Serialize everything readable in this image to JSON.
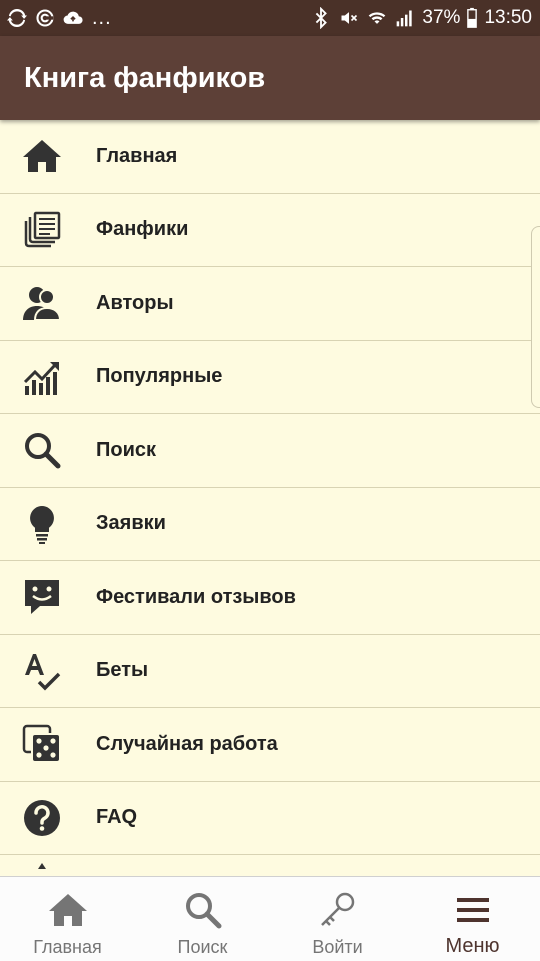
{
  "status_bar": {
    "dots": "...",
    "battery_percent": "37%",
    "time": "13:50"
  },
  "app_bar": {
    "title": "Книга фанфиков"
  },
  "menu": {
    "items": [
      {
        "label": "Главная",
        "icon": "home-icon"
      },
      {
        "label": "Фанфики",
        "icon": "documents-icon"
      },
      {
        "label": "Авторы",
        "icon": "authors-icon"
      },
      {
        "label": "Популярные",
        "icon": "trending-chart-icon"
      },
      {
        "label": "Поиск",
        "icon": "search-icon"
      },
      {
        "label": "Заявки",
        "icon": "lightbulb-icon"
      },
      {
        "label": "Фестивали отзывов",
        "icon": "chat-smile-icon"
      },
      {
        "label": "Беты",
        "icon": "spellcheck-icon"
      },
      {
        "label": "Случайная работа",
        "icon": "dice-icon"
      },
      {
        "label": "FAQ",
        "icon": "help-circle-icon"
      }
    ]
  },
  "bottom_nav": {
    "items": [
      {
        "label": "Главная",
        "icon": "home-icon"
      },
      {
        "label": "Поиск",
        "icon": "search-icon"
      },
      {
        "label": "Войти",
        "icon": "key-icon"
      },
      {
        "label": "Меню",
        "icon": "menu-icon",
        "active": true
      }
    ]
  },
  "colors": {
    "status_bar": "#4a3128",
    "app_bar": "#5d4037",
    "background": "#fefbe0",
    "icon": "#333333",
    "active_nav": "#4e342e",
    "inactive_nav": "#757575"
  }
}
